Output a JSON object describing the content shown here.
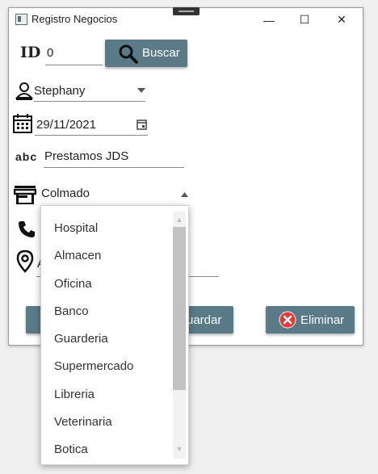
{
  "window": {
    "title": "Registro Negocios"
  },
  "titlebar": {
    "minimize_glyph": "—",
    "maximize_glyph": "☐",
    "close_glyph": "✕"
  },
  "form": {
    "id_label": "ID",
    "id_value": "0",
    "search_button_label": "Buscar",
    "user_value": "Stephany",
    "date_value": "29/11/2021",
    "abc_label": "abc",
    "name_value": "Prestamos JDS",
    "type_value": "Colmado",
    "address_partial": "A"
  },
  "buttons": {
    "save_partial_label": "uardar",
    "delete_label": "Eliminar"
  },
  "dropdown": {
    "items": [
      "Hospital",
      "Almacen",
      "Oficina",
      "Banco",
      "Guarderia",
      "Supermercado",
      "Libreria",
      "Veterinaria",
      "Botica"
    ]
  },
  "colors": {
    "button_bg": "#5b7a88",
    "delete_icon": "#e53935",
    "window_bg": "#ffffff"
  },
  "icons": [
    "app-icon",
    "search-icon",
    "person-icon",
    "calendar-icon",
    "abc-icon",
    "store-icon",
    "phone-icon",
    "location-icon",
    "delete-icon",
    "chevron-down-icon",
    "chevron-up-icon"
  ]
}
